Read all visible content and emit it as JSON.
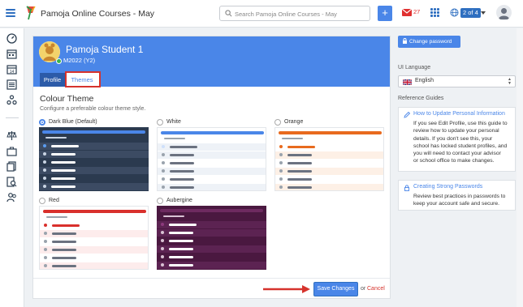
{
  "topbar": {
    "app_title": "Pamoja Online Courses - May",
    "search_placeholder": "Search Pamoja Online Courses - May",
    "add_label": "+",
    "mail_count": "27",
    "page_indicator": "2 of 4",
    "colors": {
      "brand": "#4a86e8",
      "alert": "#e03131"
    }
  },
  "profile": {
    "name": "Pamoja Student 1",
    "class": "M2022 (Y2)",
    "tabs": [
      {
        "label": "Profile",
        "active": false
      },
      {
        "label": "Themes",
        "active": true
      }
    ]
  },
  "themes_section": {
    "title": "Colour Theme",
    "description": "Configure a preferable colour theme style.",
    "options": [
      {
        "label": "Dark Blue (Default)",
        "selected": true,
        "colors": {
          "bg": "#2b3a4f",
          "accent": "#4a86e8",
          "row": "#3c4b63",
          "line": "#ffffff",
          "dot": "#c9d4e3",
          "active": "#5a9cf0"
        }
      },
      {
        "label": "White",
        "selected": false,
        "colors": {
          "bg": "#ffffff",
          "accent": "#4a86e8",
          "row": "#eef2f7",
          "line": "#6b7280",
          "dot": "#9aa3ad",
          "active": "#cfe0fb"
        }
      },
      {
        "label": "Orange",
        "selected": false,
        "colors": {
          "bg": "#ffffff",
          "accent": "#e86a1e",
          "row": "#fdf0e6",
          "line": "#6b7280",
          "dot": "#9aa3ad",
          "active": "#e86a1e"
        }
      },
      {
        "label": "Red",
        "selected": false,
        "colors": {
          "bg": "#ffffff",
          "accent": "#d9302c",
          "row": "#fdecec",
          "line": "#6b7280",
          "dot": "#9aa3ad",
          "active": "#d9302c"
        }
      },
      {
        "label": "Aubergine",
        "selected": false,
        "colors": {
          "bg": "#4a1840",
          "accent": "#6e2a60",
          "row": "#5c2352",
          "line": "#ffffff",
          "dot": "#d9c2d4",
          "active": "#8c3a7c"
        }
      }
    ]
  },
  "actions": {
    "save_label": "Save Changes",
    "or_label": "or",
    "cancel_label": "Cancel"
  },
  "right_panel": {
    "change_password_label": "Change password",
    "ui_language_label": "UI Language",
    "language_value": "English",
    "reference_guides_label": "Reference Guides",
    "guides": [
      {
        "title": "How to Update Personal Information",
        "lines": [
          "If you see Edit Profile, use this guide to",
          "review how to update your personal",
          "details. If you don't see this, your",
          "school has locked student profiles, and",
          "you will need to contact your advisor",
          "or school office to make changes."
        ]
      },
      {
        "title": "Creating Strong Passwords",
        "lines": [
          "Review best practices in passwords to",
          "keep your account safe and secure."
        ]
      }
    ]
  }
}
